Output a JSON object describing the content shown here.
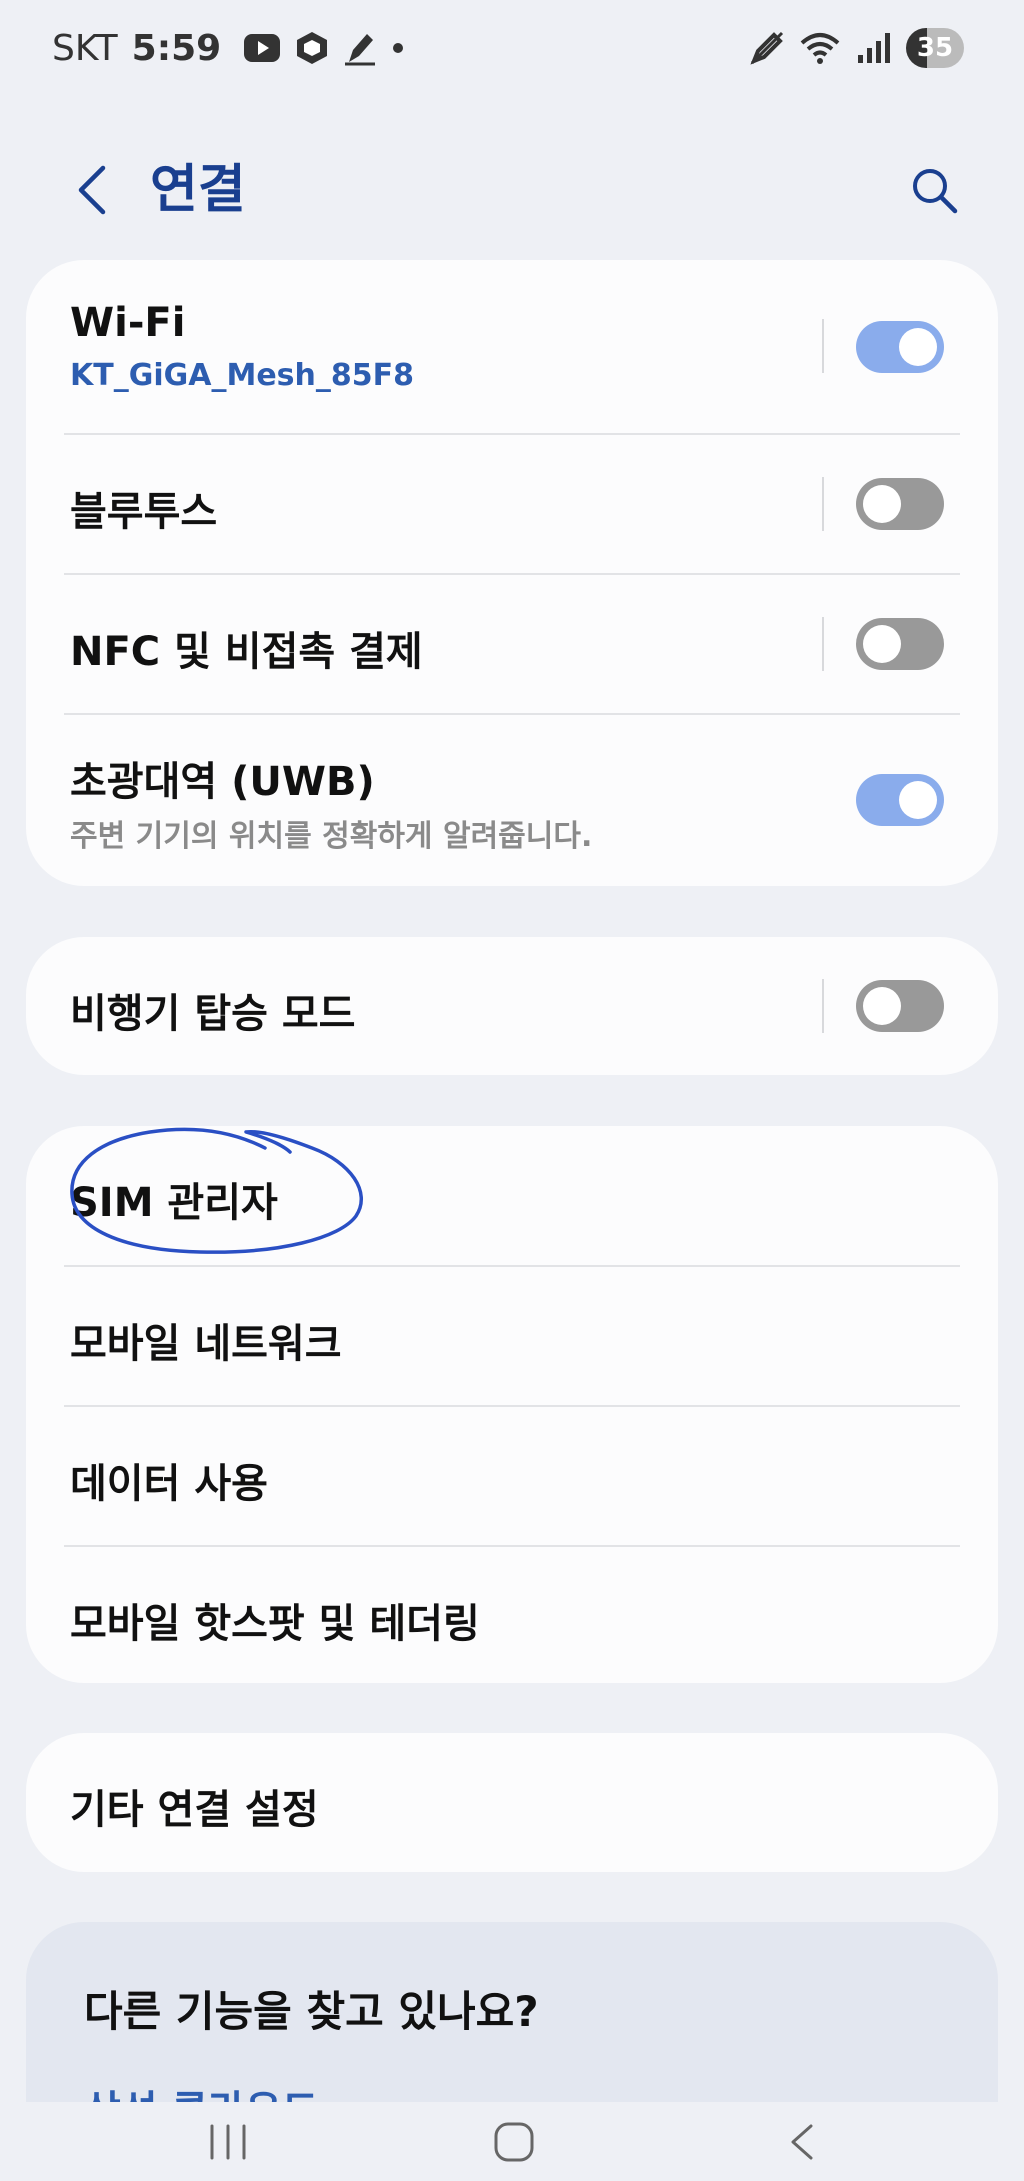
{
  "status_bar": {
    "carrier": "SKT",
    "time": "5:59",
    "battery": "35",
    "icons": [
      "youtube-icon",
      "cube-app-icon",
      "pen-app-icon",
      "notification-dot-icon",
      "stylus-icon",
      "wifi-icon",
      "signal-icon",
      "battery-icon"
    ]
  },
  "header": {
    "title": "연결",
    "back_icon": "chevron-left-icon",
    "search_icon": "search-icon"
  },
  "sections": {
    "wifi": {
      "title": "Wi-Fi",
      "subtitle": "KT_GiGA_Mesh_85F8",
      "toggle": "on"
    },
    "bluetooth": {
      "title": "블루투스",
      "toggle": "off"
    },
    "nfc": {
      "title": "NFC 및 비접촉 결제",
      "toggle": "off"
    },
    "uwb": {
      "title": "초광대역 (UWB)",
      "subtitle": "주변 기기의 위치를 정확하게 알려줍니다.",
      "toggle": "on"
    },
    "airplane": {
      "title": "비행기 탑승 모드",
      "toggle": "off"
    },
    "sim": {
      "title": "SIM 관리자"
    },
    "mobile_network": {
      "title": "모바일 네트워크"
    },
    "data_usage": {
      "title": "데이터 사용"
    },
    "hotspot": {
      "title": "모바일 핫스팟 및 테더링"
    },
    "more": {
      "title": "기타 연결 설정"
    }
  },
  "help": {
    "title": "다른 기능을 찾고 있나요?",
    "link": "삼성 클라우드"
  },
  "navbar": {
    "icons": [
      "recent-apps-icon",
      "home-icon",
      "back-icon"
    ]
  },
  "colors": {
    "background": "#eef0f5",
    "card": "#fcfcfd",
    "accent_blue": "#2d5db0",
    "title_blue": "#1a3f8f",
    "toggle_on": "#8aacec",
    "toggle_off": "#999999",
    "annotation": "#2a4fc4"
  }
}
